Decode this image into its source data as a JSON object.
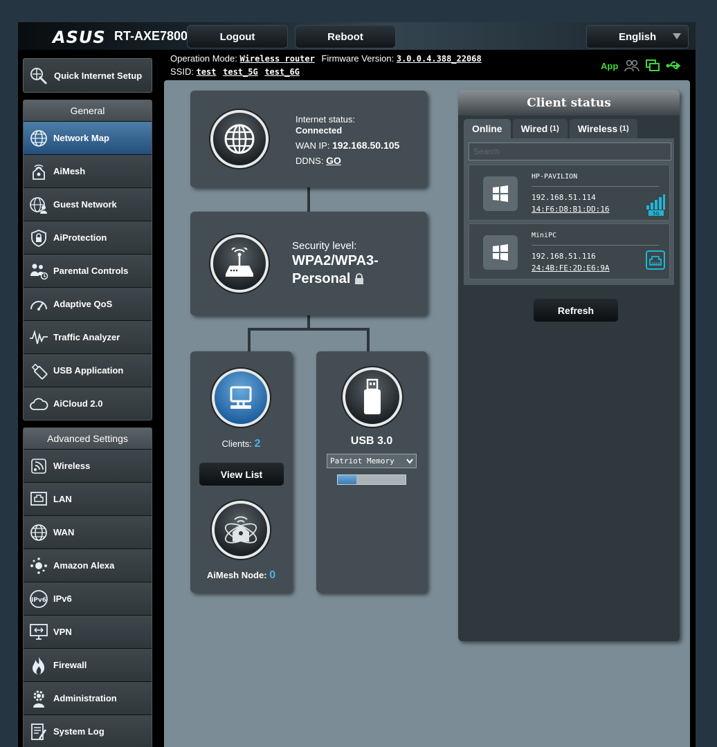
{
  "header": {
    "brand": "ASUS",
    "model": "RT-AXE7800",
    "logout_label": "Logout",
    "reboot_label": "Reboot",
    "language": "English"
  },
  "info": {
    "operation_mode_label": "Operation Mode:",
    "operation_mode": "Wireless router",
    "firmware_label": "Firmware Version:",
    "firmware": "3.0.0.4.388_22068",
    "ssid_label": "SSID:",
    "ssids": [
      "test",
      "test_5G",
      "test_6G"
    ],
    "app_label": "App"
  },
  "sidebar": {
    "quick_setup": "Quick Internet Setup",
    "general_title": "General",
    "general_items": [
      {
        "label": "Network Map",
        "icon": "globe-icon"
      },
      {
        "label": "AiMesh",
        "icon": "aimesh-icon"
      },
      {
        "label": "Guest Network",
        "icon": "guest-network-icon"
      },
      {
        "label": "AiProtection",
        "icon": "shield-lock-icon"
      },
      {
        "label": "Parental Controls",
        "icon": "family-icon"
      },
      {
        "label": "Adaptive QoS",
        "icon": "gauge-icon"
      },
      {
        "label": "Traffic Analyzer",
        "icon": "waveform-icon"
      },
      {
        "label": "USB Application",
        "icon": "usb-stick-icon"
      },
      {
        "label": "AiCloud 2.0",
        "icon": "cloud-icon"
      }
    ],
    "advanced_title": "Advanced Settings",
    "advanced_items": [
      {
        "label": "Wireless",
        "icon": "wifi-icon"
      },
      {
        "label": "LAN",
        "icon": "lan-port-icon"
      },
      {
        "label": "WAN",
        "icon": "globe-icon"
      },
      {
        "label": "Amazon Alexa",
        "icon": "alexa-icon"
      },
      {
        "label": "IPv6",
        "icon": "ipv6-icon"
      },
      {
        "label": "VPN",
        "icon": "vpn-monitor-icon"
      },
      {
        "label": "Firewall",
        "icon": "fire-icon"
      },
      {
        "label": "Administration",
        "icon": "gear-person-icon"
      },
      {
        "label": "System Log",
        "icon": "log-icon"
      }
    ]
  },
  "network_map": {
    "internet_status_label": "Internet status:",
    "internet_status": "Connected",
    "wan_ip_label": "WAN IP:",
    "wan_ip": "192.168.50.105",
    "ddns_label": "DDNS:",
    "ddns_link": "GO",
    "security_label": "Security level:",
    "security_line1": "WPA2/WPA3-",
    "security_line2": "Personal",
    "clients_label": "Clients:",
    "clients_count": "2",
    "view_list_label": "View List",
    "aimesh_label": "AiMesh Node:",
    "aimesh_count": "0",
    "usb_label": "USB 3.0",
    "usb_device": "Patriot Memory",
    "usb_usage_fraction": 0.28
  },
  "client_status": {
    "title": "Client status",
    "tabs": [
      {
        "label": "Online",
        "count": ""
      },
      {
        "label": "Wired",
        "count": "(1)"
      },
      {
        "label": "Wireless",
        "count": "(1)"
      }
    ],
    "search_placeholder": "Search",
    "clients": [
      {
        "name": "HP-PAVILION",
        "ip": "192.168.51.114",
        "mac": "14:F6:D8:B1:DD:16",
        "connection": "5G"
      },
      {
        "name": "MiniPC",
        "ip": "192.168.51.116",
        "mac": "24:4B:FE:2D:E6:9A",
        "connection": "wired"
      }
    ],
    "refresh_label": "Refresh"
  },
  "colors": {
    "accent_blue": "#4db3e9",
    "status_green": "#3fd53f",
    "cyan": "#1fb6d6"
  }
}
